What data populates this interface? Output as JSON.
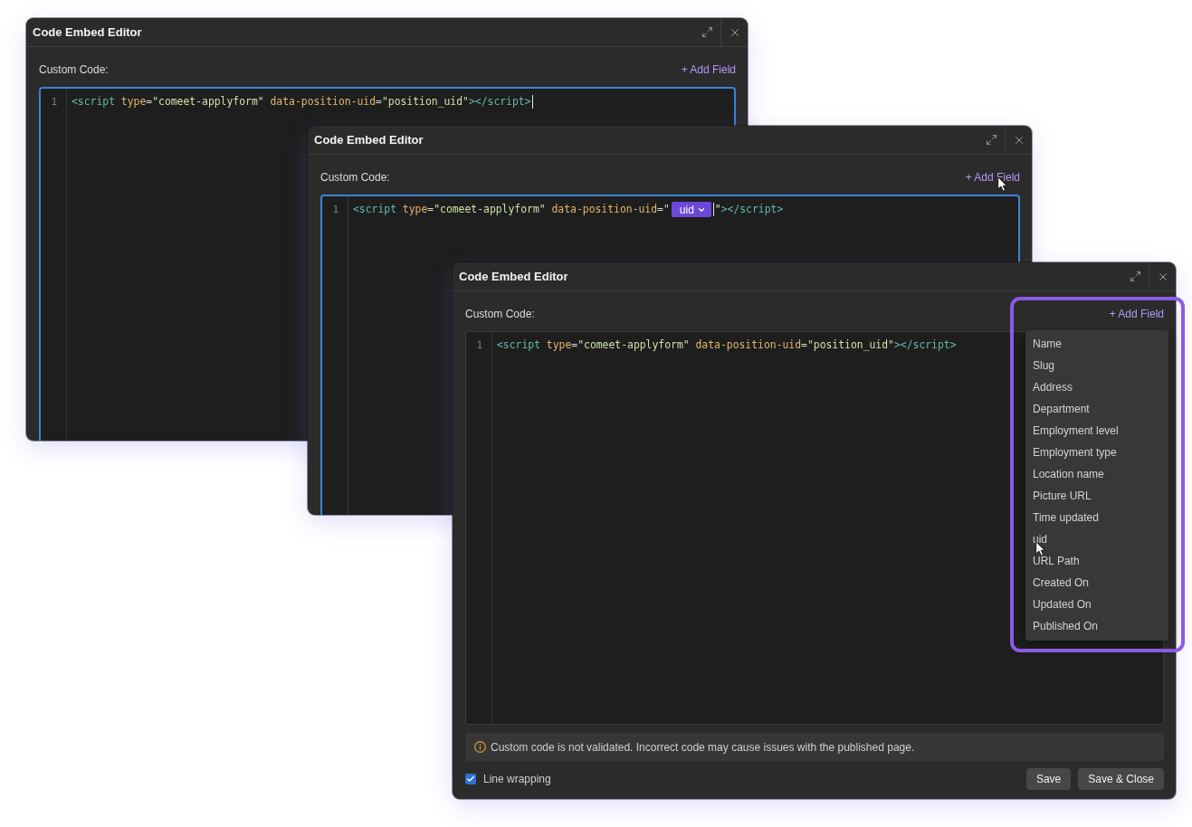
{
  "windows": [
    {
      "title": "Code Embed Editor",
      "field_label": "Custom Code:",
      "add_field": {
        "label": "+ Add Field",
        "hovered": false
      },
      "editor": {
        "focused": true,
        "lines": [
          {
            "number": "1",
            "segments": [
              {
                "kind": "code",
                "tokens": [
                  {
                    "kind": "tag",
                    "text": "<script"
                  },
                  {
                    "kind": "attr",
                    "text": " type"
                  },
                  {
                    "kind": "punct",
                    "text": "="
                  },
                  {
                    "kind": "string",
                    "text": "\"comeet-applyform\""
                  },
                  {
                    "kind": "attr",
                    "text": " data-position-uid"
                  },
                  {
                    "kind": "punct",
                    "text": "="
                  },
                  {
                    "kind": "string",
                    "text": "\"position_uid\""
                  },
                  {
                    "kind": "tag",
                    "text": "></script>"
                  }
                ]
              },
              {
                "kind": "cursor"
              }
            ]
          }
        ]
      }
    },
    {
      "title": "Code Embed Editor",
      "field_label": "Custom Code:",
      "add_field": {
        "label": "+ Add Field",
        "hovered": true
      },
      "editor": {
        "focused": true,
        "lines": [
          {
            "number": "1",
            "segments": [
              {
                "kind": "code",
                "tokens": [
                  {
                    "kind": "tag",
                    "text": "<script"
                  },
                  {
                    "kind": "attr",
                    "text": " type"
                  },
                  {
                    "kind": "punct",
                    "text": "="
                  },
                  {
                    "kind": "string",
                    "text": "\"comeet-applyform\""
                  },
                  {
                    "kind": "attr",
                    "text": " data-position-uid"
                  },
                  {
                    "kind": "punct",
                    "text": "="
                  },
                  {
                    "kind": "string",
                    "text": "\""
                  }
                ]
              },
              {
                "kind": "chip",
                "label": "uid"
              },
              {
                "kind": "cursor"
              },
              {
                "kind": "code",
                "tokens": [
                  {
                    "kind": "string",
                    "text": "\""
                  },
                  {
                    "kind": "tag",
                    "text": "></script>"
                  }
                ]
              }
            ]
          }
        ]
      }
    },
    {
      "title": "Code Embed Editor",
      "field_label": "Custom Code:",
      "add_field": {
        "label": "+ Add Field",
        "hovered": false
      },
      "highlight_frame": true,
      "editor": {
        "focused": false,
        "lines": [
          {
            "number": "1",
            "segments": [
              {
                "kind": "code",
                "tokens": [
                  {
                    "kind": "tag",
                    "text": "<script"
                  },
                  {
                    "kind": "attr",
                    "text": " type"
                  },
                  {
                    "kind": "punct",
                    "text": "="
                  },
                  {
                    "kind": "string",
                    "text": "\"comeet-applyform\""
                  },
                  {
                    "kind": "attr",
                    "text": " data-position-uid"
                  },
                  {
                    "kind": "punct",
                    "text": "="
                  },
                  {
                    "kind": "string",
                    "text": "\"position_uid\""
                  },
                  {
                    "kind": "tag",
                    "text": "></script>"
                  }
                ]
              }
            ]
          }
        ]
      },
      "field_menu": {
        "items": [
          {
            "label": "Name",
            "hovered": false
          },
          {
            "label": "Slug",
            "hovered": false
          },
          {
            "label": "Address",
            "hovered": false
          },
          {
            "label": "Department",
            "hovered": false
          },
          {
            "label": "Employment level",
            "hovered": false
          },
          {
            "label": "Employment type",
            "hovered": false
          },
          {
            "label": "Location name",
            "hovered": false
          },
          {
            "label": "Picture URL",
            "hovered": false
          },
          {
            "label": "Time updated",
            "hovered": false
          },
          {
            "label": "uid",
            "hovered": true
          },
          {
            "label": "URL Path",
            "hovered": false
          },
          {
            "label": "Created On",
            "hovered": false
          },
          {
            "label": "Updated On",
            "hovered": false
          },
          {
            "label": "Published On",
            "hovered": false
          }
        ]
      },
      "notice": "Custom code is not validated. Incorrect code may cause issues with the published page.",
      "line_wrapping": {
        "label": "Line wrapping",
        "checked": true
      },
      "buttons": [
        "Save",
        "Save & Close"
      ]
    }
  ]
}
